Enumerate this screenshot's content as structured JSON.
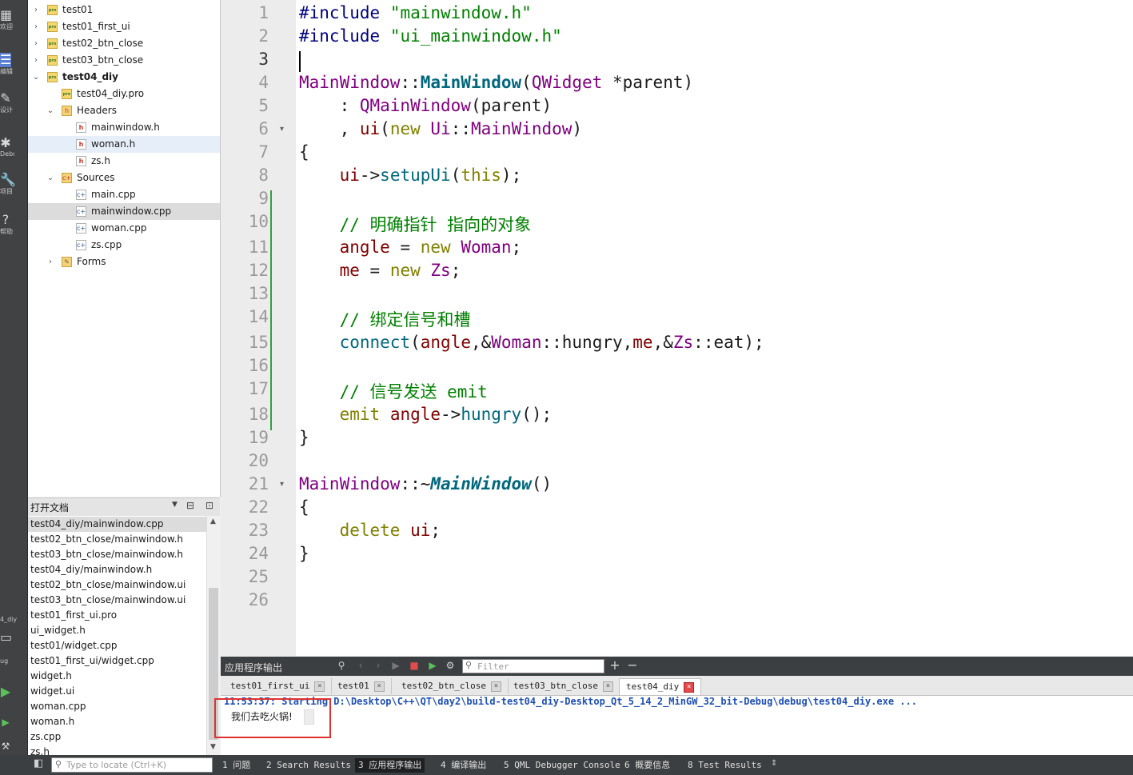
{
  "colors": {
    "accent": "#5b7fd0",
    "highlight_box": "#e03131",
    "output_run_text": "#1e4fb5",
    "changebar": "#2ea043"
  },
  "modebar": {
    "items": [
      {
        "icon": "grid-icon",
        "label": "欢迎"
      },
      {
        "icon": "edit-icon",
        "label": "编辑"
      },
      {
        "icon": "design-icon",
        "label": "设计"
      },
      {
        "icon": "debug-icon",
        "label": "Debug"
      },
      {
        "icon": "project-icon",
        "label": "项目"
      },
      {
        "icon": "help-icon",
        "label": "帮助"
      }
    ],
    "kit_label": "4_diy",
    "kit_sub": "ug"
  },
  "project_tree": {
    "items": [
      {
        "label": "test01",
        "type": "project",
        "arrow": "collapsed"
      },
      {
        "label": "test01_first_ui",
        "type": "project",
        "arrow": "collapsed"
      },
      {
        "label": "test02_btn_close",
        "type": "project",
        "arrow": "collapsed"
      },
      {
        "label": "test03_btn_close",
        "type": "project",
        "arrow": "collapsed"
      },
      {
        "label": "test04_diy",
        "type": "project",
        "arrow": "expanded"
      },
      {
        "label": "test04_diy.pro",
        "type": "pro"
      },
      {
        "label": "Headers",
        "type": "folder",
        "arrow": "expanded"
      },
      {
        "label": "mainwindow.h",
        "type": "h"
      },
      {
        "label": "woman.h",
        "type": "h"
      },
      {
        "label": "zs.h",
        "type": "h"
      },
      {
        "label": "Sources",
        "type": "folder",
        "arrow": "expanded"
      },
      {
        "label": "main.cpp",
        "type": "cpp"
      },
      {
        "label": "mainwindow.cpp",
        "type": "cpp"
      },
      {
        "label": "woman.cpp",
        "type": "cpp"
      },
      {
        "label": "zs.cpp",
        "type": "cpp"
      },
      {
        "label": "Forms",
        "type": "forms",
        "arrow": "collapsed"
      }
    ]
  },
  "open_docs": {
    "title": "打开文档",
    "items": [
      "test04_diy/mainwindow.cpp",
      "test02_btn_close/mainwindow.h",
      "test03_btn_close/mainwindow.h",
      "test04_diy/mainwindow.h",
      "test02_btn_close/mainwindow.ui",
      "test03_btn_close/mainwindow.ui",
      "test01_first_ui.pro",
      "ui_widget.h",
      "test01/widget.cpp",
      "test01_first_ui/widget.cpp",
      "widget.h",
      "widget.ui",
      "woman.cpp",
      "woman.h",
      "zs.cpp",
      "zs.h"
    ]
  },
  "editor": {
    "current_line": 3,
    "line_numbers": [
      "1",
      "2",
      "3",
      "4",
      "5",
      "6",
      "7",
      "8",
      "9",
      "10",
      "11",
      "12",
      "13",
      "14",
      "15",
      "16",
      "17",
      "18",
      "19",
      "20",
      "21",
      "22",
      "23",
      "24",
      "25",
      "26"
    ],
    "lines": [
      "#include \"mainwindow.h\"",
      "#include \"ui_mainwindow.h\"",
      "",
      "MainWindow::MainWindow(QWidget *parent)",
      "    : QMainWindow(parent)",
      "    , ui(new Ui::MainWindow)",
      "{",
      "    ui->setupUi(this);",
      "",
      "    // 明确指针 指向的对象",
      "    angle = new Woman;",
      "    me = new Zs;",
      "",
      "    // 绑定信号和槽",
      "    connect(angle,&Woman::hungry,me,&Zs::eat);",
      "",
      "    // 信号发送 emit",
      "    emit angle->hungry();",
      "}",
      "",
      "MainWindow::~MainWindow()",
      "{",
      "    delete ui;",
      "}",
      "",
      ""
    ]
  },
  "output": {
    "title": "应用程序输出",
    "filter_placeholder": "Filter",
    "tabs": [
      "test01_first_ui",
      "test01",
      "test02_btn_close",
      "test03_btn_close",
      "test04_diy"
    ],
    "active_tab": "test04_diy",
    "run_line": "11:53:37: Starting D:\\Desktop\\C++\\QT\\day2\\build-test04_diy-Desktop_Qt_5_14_2_MinGW_32_bit-Debug\\debug\\test04_diy.exe ...",
    "program_output": "我们去吃火锅!"
  },
  "statusbar": {
    "locator_placeholder": "Type to locate (Ctrl+K)",
    "tabs": [
      {
        "num": "1",
        "label": "问题"
      },
      {
        "num": "2",
        "label": "Search Results"
      },
      {
        "num": "3",
        "label": "应用程序输出"
      },
      {
        "num": "4",
        "label": "编译输出"
      },
      {
        "num": "5",
        "label": "QML Debugger Console"
      },
      {
        "num": "6",
        "label": "概要信息"
      },
      {
        "num": "8",
        "label": "Test Results"
      }
    ],
    "active_tab": "3"
  }
}
